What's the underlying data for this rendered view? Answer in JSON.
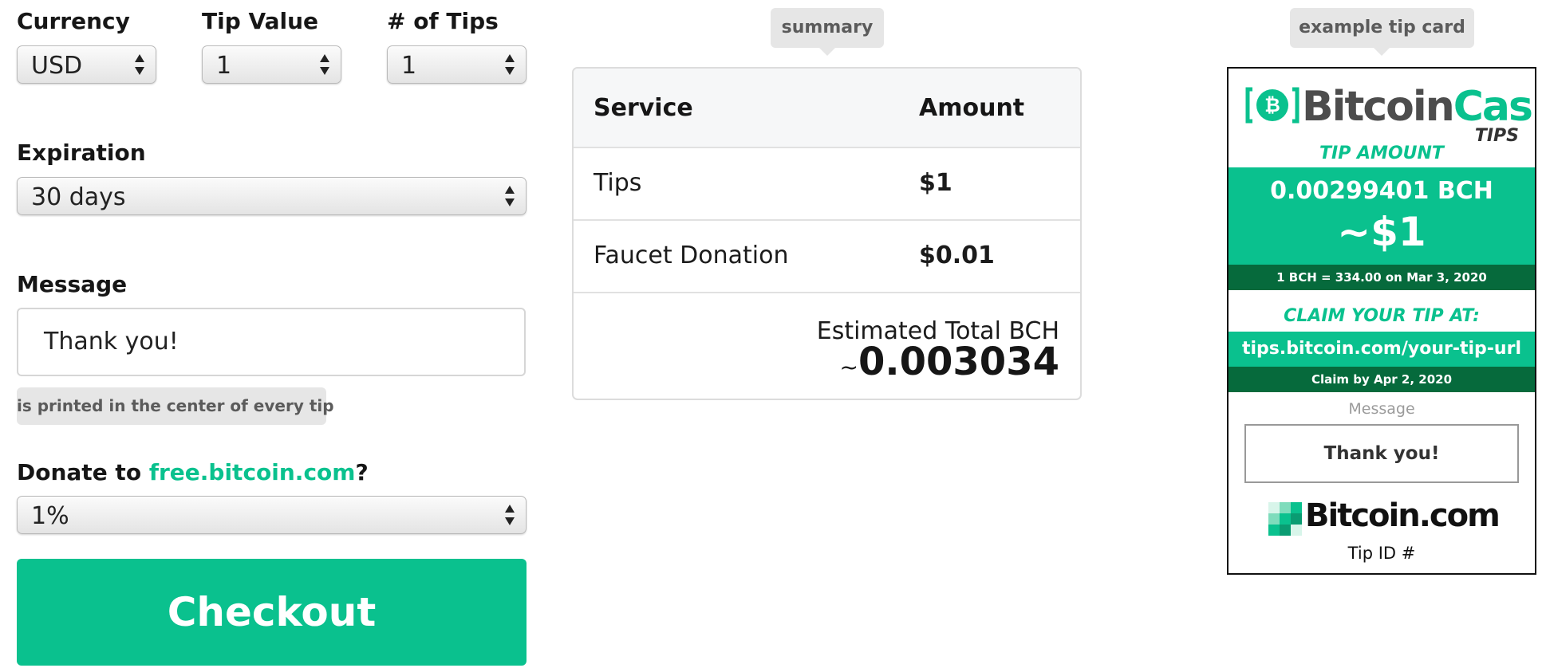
{
  "form": {
    "currency": {
      "label": "Currency",
      "value": "USD"
    },
    "tip_value": {
      "label": "Tip Value",
      "value": "1"
    },
    "num_tips": {
      "label": "# of Tips",
      "value": "1"
    },
    "expiration": {
      "label": "Expiration",
      "value": "30 days"
    },
    "message": {
      "label": "Message",
      "value": "Thank you!",
      "hint": "is printed in the center of every tip"
    },
    "donate": {
      "label_prefix": "Donate to ",
      "link": "free.bitcoin.com",
      "label_suffix": "?",
      "value": "1%"
    },
    "checkout_label": "Checkout"
  },
  "summary": {
    "tab_label": "summary",
    "header": {
      "service": "Service",
      "amount": "Amount"
    },
    "rows": [
      {
        "service": "Tips",
        "amount": "$1"
      },
      {
        "service": "Faucet Donation",
        "amount": "$0.01"
      }
    ],
    "total_label": "Estimated Total BCH",
    "total_prefix": "~",
    "total_value": "0.003034"
  },
  "card": {
    "tab_label": "example tip card",
    "brand_part1": "Bitcoin",
    "brand_part2": "Cash",
    "brand_sub": "TIPS",
    "tip_amount_label": "TIP AMOUNT",
    "bch_amount": "0.00299401 BCH",
    "usd_amount": "~$1",
    "rate_line": "1 BCH = 334.00 on Mar 3, 2020",
    "claim_label": "CLAIM YOUR TIP AT:",
    "claim_url": "tips.bitcoin.com/your-tip-url",
    "claim_by": "Claim by Apr 2, 2020",
    "message_label": "Message",
    "message_text": "Thank you!",
    "footer_brand": "Bitcoin.com",
    "tip_id_label": "Tip ID #"
  },
  "colors": {
    "accent": "#0ac18e",
    "dark_green": "#066a3c",
    "chip": "#e6e6e6"
  },
  "icons": [
    "bitcoin-cash-coin-icon",
    "bitcoin-com-logo-icon",
    "select-arrows-icon"
  ]
}
